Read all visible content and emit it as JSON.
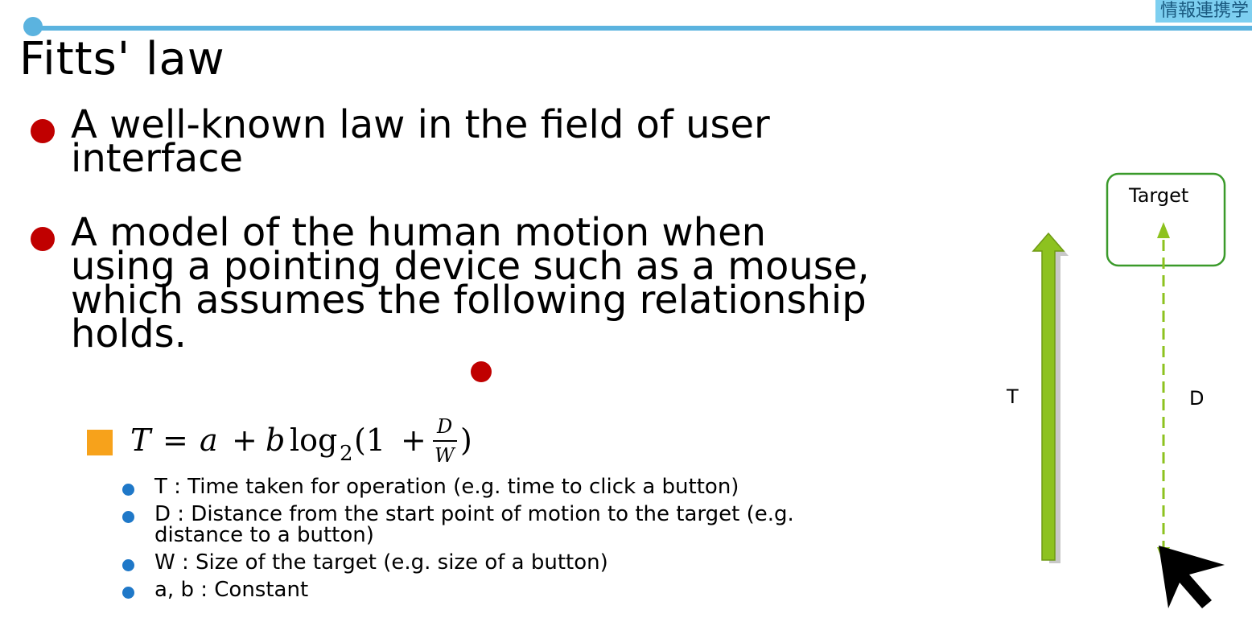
{
  "header": {
    "corner_tag": "情報連携学"
  },
  "title": "Fitts' law",
  "bullets": [
    {
      "text": "A well-known law in the field of user\ninterface"
    },
    {
      "text": "A model of the human motion when\nusing a pointing device such as a mouse,\nwhich assumes the following relationship\nholds."
    }
  ],
  "formula": {
    "T": "T",
    "eq": "=",
    "a": "a",
    "plus1": "+",
    "b": "b",
    "log": "log",
    "base": "2",
    "open": "(1",
    "plus2": "+",
    "num": "D",
    "den": "W",
    "close": ")"
  },
  "definitions": [
    "T : Time taken for operation (e.g. time to click a button)",
    "D : Distance from the start point of motion to the target (e.g.\ndistance to a button)",
    "W : Size of the target (e.g. size of a button)",
    "a, b : Constant"
  ],
  "diagram": {
    "target_label": "Target",
    "time_label": "T",
    "distance_label": "D"
  },
  "colors": {
    "accent_blue": "#5bb3df",
    "bullet_red": "#c00000",
    "square_orange": "#f7a21b",
    "sub_bullet_blue": "#1f78c8",
    "arrow_green": "#8dc21f",
    "target_border": "#3a9a2a"
  }
}
